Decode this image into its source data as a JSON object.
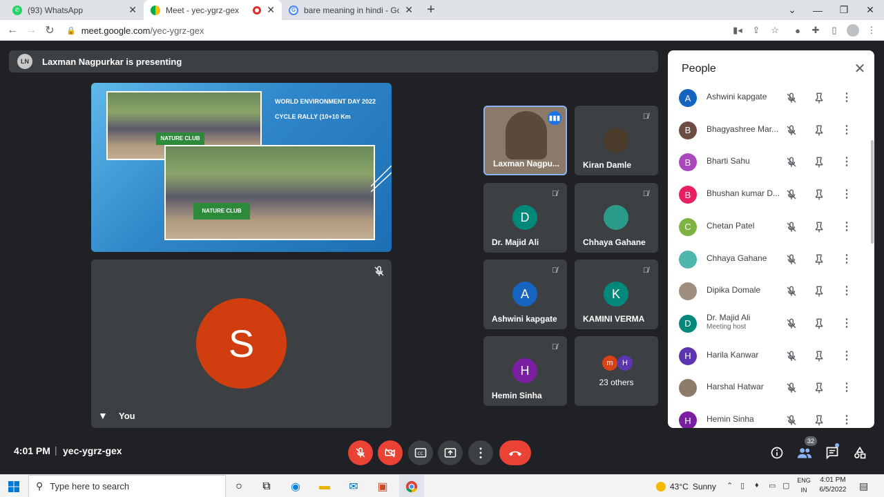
{
  "browser": {
    "tabs": [
      {
        "title": "(93) WhatsApp",
        "favicon": "whatsapp-icon",
        "active": false
      },
      {
        "title": "Meet - yec-ygrz-gex",
        "favicon": "meet-icon",
        "active": true
      },
      {
        "title": "bare meaning in hindi - Google S",
        "favicon": "google-icon",
        "active": false
      }
    ],
    "url_host": "meet.google.com",
    "url_path": "/yec-ygrz-gex"
  },
  "presenting": {
    "text": "Laxman Nagpurkar is presenting"
  },
  "slide": {
    "title_line1": "WORLD ENVIRONMENT DAY 2022",
    "title_line2": "CYCLE RALLY (10+10 Km",
    "banner1": "NATURE CLUB",
    "banner2": "NATURE CLUB"
  },
  "self_tile": {
    "initial": "S",
    "label": "You"
  },
  "tiles": [
    {
      "name": "Laxman Nagpu...",
      "initial": "",
      "color": "#8a7a6a",
      "speaking": true
    },
    {
      "name": "Kiran Damle",
      "initial": "",
      "color": "#4a3a2a",
      "speaking": false
    },
    {
      "name": "Dr. Majid Ali",
      "initial": "D",
      "color": "#00897b",
      "speaking": false
    },
    {
      "name": "Chhaya Gahane",
      "initial": "",
      "color": "#2a9a8a",
      "speaking": false
    },
    {
      "name": "Ashwini kapgate",
      "initial": "A",
      "color": "#1565c0",
      "speaking": false
    },
    {
      "name": "KAMINI VERMA",
      "initial": "K",
      "color": "#00897b",
      "speaking": false
    },
    {
      "name": "Hemin Sinha",
      "initial": "H",
      "color": "#7b1fa2",
      "speaking": false
    }
  ],
  "others_tile": {
    "label": "23 others",
    "avatars": [
      {
        "initial": "m",
        "color": "#d84315"
      },
      {
        "initial": "H",
        "color": "#5e35b1"
      }
    ]
  },
  "people_panel": {
    "title": "People",
    "rows": [
      {
        "name": "Ashwini kapgate",
        "initial": "A",
        "color": "#1565c0",
        "sub": ""
      },
      {
        "name": "Bhagyashree Mar...",
        "initial": "B",
        "color": "#6d4c41",
        "sub": ""
      },
      {
        "name": "Bharti Sahu",
        "initial": "B",
        "color": "#ab47bc",
        "sub": ""
      },
      {
        "name": "Bhushan kumar D...",
        "initial": "B",
        "color": "#e91e63",
        "sub": ""
      },
      {
        "name": "Chetan Patel",
        "initial": "C",
        "color": "#7cb342",
        "sub": ""
      },
      {
        "name": "Chhaya Gahane",
        "initial": "",
        "color": "#4db6ac",
        "sub": ""
      },
      {
        "name": "Dipika Domale",
        "initial": "",
        "color": "#9e8e80",
        "sub": ""
      },
      {
        "name": "Dr. Majid Ali",
        "initial": "D",
        "color": "#00897b",
        "sub": "Meeting host"
      },
      {
        "name": "Harila Kanwar",
        "initial": "H",
        "color": "#5e35b1",
        "sub": ""
      },
      {
        "name": "Harshal Hatwar",
        "initial": "",
        "color": "#8d7b6a",
        "sub": ""
      },
      {
        "name": "Hemin Sinha",
        "initial": "H",
        "color": "#7b1fa2",
        "sub": ""
      }
    ]
  },
  "bottom_bar": {
    "time": "4:01 PM",
    "separator": "|",
    "meeting_code": "yec-ygrz-gex",
    "people_count": "32"
  },
  "taskbar": {
    "search_placeholder": "Type here to search",
    "weather_temp": "43°C",
    "weather_text": "Sunny",
    "lang_line1": "ENG",
    "lang_line2": "IN",
    "clock_time": "4:01 PM",
    "clock_date": "6/5/2022"
  }
}
